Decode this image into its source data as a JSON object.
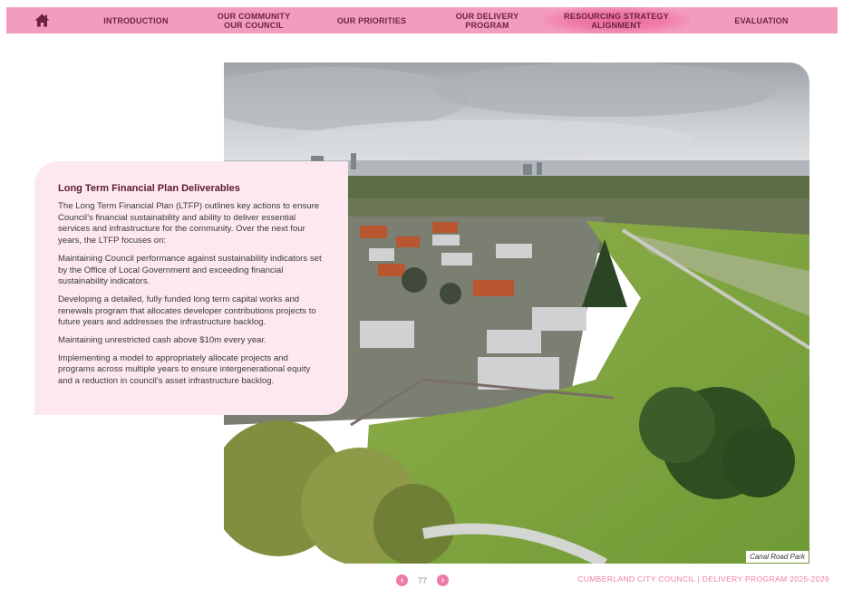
{
  "nav": {
    "home_icon": "home-icon",
    "items": [
      {
        "label": "INTRODUCTION"
      },
      {
        "label": "OUR COMMUNITY\nOUR COUNCIL"
      },
      {
        "label": "OUR PRIORITIES"
      },
      {
        "label": "OUR DELIVERY\nPROGRAM"
      },
      {
        "label": "RESOURCING STRATEGY\nALIGNMENT",
        "active": true
      },
      {
        "label": "EVALUATION"
      }
    ],
    "bar_color": "#f39dbe",
    "text_color": "#6b2340"
  },
  "card": {
    "title": "Long Term Financial Plan Deliverables",
    "paragraphs": [
      "The Long Term Financial Plan (LTFP) outlines key actions to ensure Council’s financial sustainability and ability to deliver essential services and infrastructure for the community. Over the next four years, the LTFP focuses on:",
      "Maintaining Council performance against sustainability indicators set by the Office of Local Government and exceeding financial sustainability indicators.",
      "Developing a detailed, fully funded long term capital works and renewals program that allocates developer contributions projects to future years and addresses the infrastructure backlog.",
      "Maintaining unrestricted cash above $10m every year.",
      "Implementing a model to appropriately allocate projects and programs across multiple years to ensure intergenerational equity and a reduction in council’s asset infrastructure backlog."
    ],
    "background": "#fde8ef"
  },
  "photo": {
    "caption": "Canal Road Park"
  },
  "footer": {
    "page_number": "77",
    "prev_icon": "chevron-left-icon",
    "next_icon": "chevron-right-icon",
    "title": "CUMBERLAND CITY COUNCIL | DELIVERY PROGRAM 2025-2029",
    "accent": "#f07ba8"
  }
}
